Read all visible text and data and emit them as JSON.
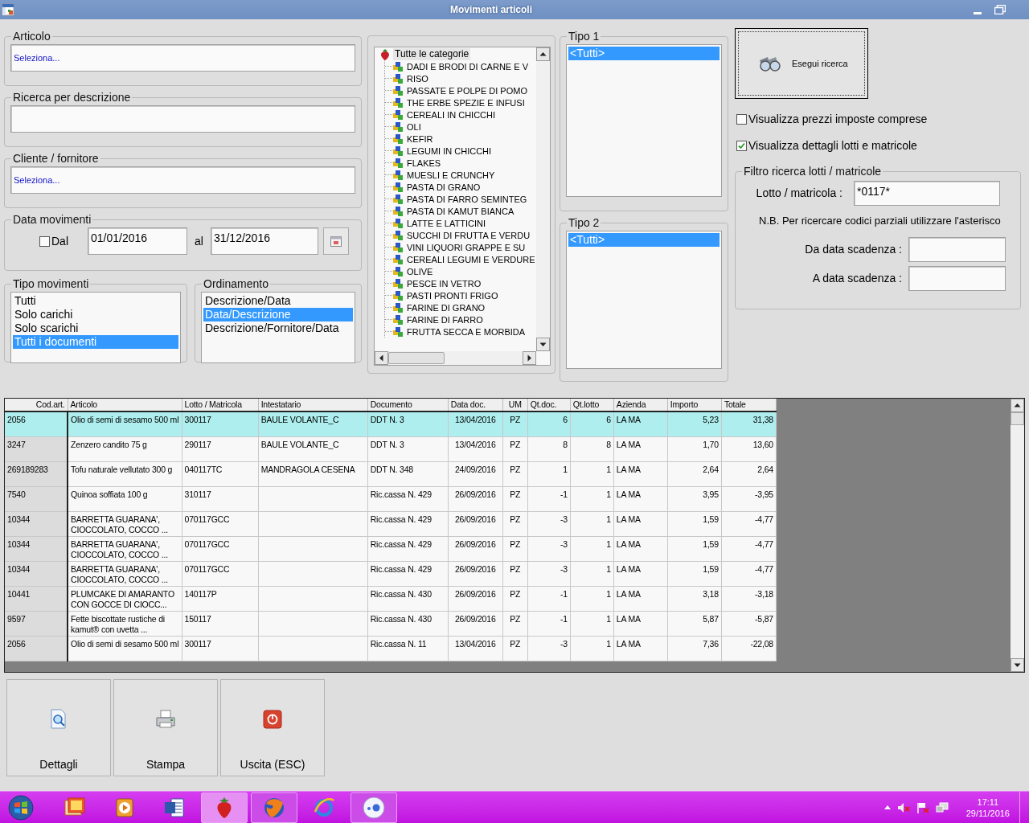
{
  "window": {
    "title": "Movimenti articoli"
  },
  "articolo": {
    "label": "Articolo",
    "value": "Seleziona..."
  },
  "ricerca_descrizione": {
    "label": "Ricerca per descrizione"
  },
  "cliente_fornitore": {
    "label": "Cliente / fornitore",
    "value": "Seleziona..."
  },
  "data_movimenti": {
    "label": "Data movimenti",
    "dal": {
      "label": "Dal",
      "checked": false
    },
    "from": "01/01/2016",
    "al_label": "al",
    "to": "31/12/2016"
  },
  "tipo_movimenti": {
    "label": "Tipo movimenti",
    "items": [
      {
        "label": "Tutti",
        "selected": false
      },
      {
        "label": "Solo carichi",
        "selected": false
      },
      {
        "label": "Solo scarichi",
        "selected": false
      },
      {
        "label": "Tutti i documenti",
        "selected": true
      }
    ]
  },
  "ordinamento": {
    "label": "Ordinamento",
    "items": [
      {
        "label": "Descrizione/Data",
        "selected": false
      },
      {
        "label": "Data/Descrizione",
        "selected": true
      },
      {
        "label": "Descrizione/Fornitore/Data",
        "selected": false
      }
    ]
  },
  "categories": {
    "label": "Tutte le categorie",
    "children": [
      {
        "label": "DADI E BRODI DI CARNE E V"
      },
      {
        "label": "RISO"
      },
      {
        "label": "PASSATE E POLPE DI POMO"
      },
      {
        "label": "THE ERBE SPEZIE E INFUSI"
      },
      {
        "label": "CEREALI IN CHICCHI"
      },
      {
        "label": "OLI"
      },
      {
        "label": "KEFIR"
      },
      {
        "label": "LEGUMI IN CHICCHI"
      },
      {
        "label": "FLAKES"
      },
      {
        "label": "MUESLI E CRUNCHY"
      },
      {
        "label": "PASTA DI GRANO"
      },
      {
        "label": "PASTA DI FARRO SEMINTEG"
      },
      {
        "label": "PASTA DI KAMUT BIANCA"
      },
      {
        "label": "LATTE E LATTICINI"
      },
      {
        "label": "SUCCHI DI FRUTTA E VERDU"
      },
      {
        "label": "VINI LIQUORI GRAPPE E SU"
      },
      {
        "label": "CEREALI LEGUMI E VERDURE"
      },
      {
        "label": "OLIVE"
      },
      {
        "label": "PESCE IN VETRO"
      },
      {
        "label": "PASTI PRONTI FRIGO"
      },
      {
        "label": "FARINE DI GRANO"
      },
      {
        "label": "FARINE DI FARRO"
      },
      {
        "label": "FRUTTA SECCA E MORBIDA"
      }
    ]
  },
  "tipo1": {
    "label": "Tipo 1",
    "items": [
      {
        "label": "<Tutti>",
        "selected": true
      }
    ]
  },
  "tipo2": {
    "label": "Tipo 2",
    "items": [
      {
        "label": "<Tutti>",
        "selected": true
      }
    ]
  },
  "search_button": {
    "label": "Esegui ricerca"
  },
  "options": [
    {
      "label": "Visualizza prezzi imposte comprese",
      "checked": false
    },
    {
      "label": "Visualizza dettagli lotti e matricole",
      "checked": true
    }
  ],
  "filtro_lotti": {
    "label": "Filtro ricerca lotti / matricole",
    "lotto_label": "Lotto / matricola :",
    "lotto_value": "*0117*",
    "note": "N.B. Per ricercare codici parziali utilizzare l'asterisco",
    "da_label": "Da data scadenza :",
    "a_label": "A data scadenza :"
  },
  "table": {
    "columns": [
      "Cod.art.",
      "Articolo",
      "Lotto / Matricola",
      "Intestatario",
      "Documento",
      "Data doc.",
      "UM",
      "Qt.doc.",
      "Qt.lotto",
      "Azienda",
      "Importo",
      "Totale"
    ],
    "rows": [
      {
        "selected": true,
        "cells": [
          "2056",
          "Olio di semi di sesamo 500 ml",
          "300117",
          "BAULE VOLANTE_C",
          "DDT N. 3",
          "13/04/2016",
          "PZ",
          "6",
          "6",
          "LA MA",
          "5,23",
          "31,38"
        ]
      },
      {
        "selected": false,
        "cells": [
          "3247",
          "Zenzero candito 75 g",
          "290117",
          "BAULE VOLANTE_C",
          "DDT N. 3",
          "13/04/2016",
          "PZ",
          "8",
          "8",
          "LA MA",
          "1,70",
          "13,60"
        ]
      },
      {
        "selected": false,
        "cells": [
          "269189283",
          "Tofu naturale vellutato 300 g",
          "040117TC",
          "MANDRAGOLA CESENA",
          "DDT N. 348",
          "24/09/2016",
          "PZ",
          "1",
          "1",
          "LA MA",
          "2,64",
          "2,64"
        ]
      },
      {
        "selected": false,
        "cells": [
          "7540",
          "Quinoa soffiata 100 g",
          "310117",
          "",
          "Ric.cassa N. 429",
          "26/09/2016",
          "PZ",
          "-1",
          "1",
          "LA MA",
          "3,95",
          "-3,95"
        ]
      },
      {
        "selected": false,
        "cells": [
          "10344",
          "BARRETTA GUARANA', CIOCCOLATO, COCCO ...",
          "070117GCC",
          "",
          "Ric.cassa N. 429",
          "26/09/2016",
          "PZ",
          "-3",
          "1",
          "LA MA",
          "1,59",
          "-4,77"
        ]
      },
      {
        "selected": false,
        "cells": [
          "10344",
          "BARRETTA GUARANA', CIOCCOLATO, COCCO ...",
          "070117GCC",
          "",
          "Ric.cassa N. 429",
          "26/09/2016",
          "PZ",
          "-3",
          "1",
          "LA MA",
          "1,59",
          "-4,77"
        ]
      },
      {
        "selected": false,
        "cells": [
          "10344",
          "BARRETTA GUARANA', CIOCCOLATO, COCCO ...",
          "070117GCC",
          "",
          "Ric.cassa N. 429",
          "26/09/2016",
          "PZ",
          "-3",
          "1",
          "LA MA",
          "1,59",
          "-4,77"
        ]
      },
      {
        "selected": false,
        "cells": [
          "10441",
          "PLUMCAKE DI AMARANTO CON GOCCE DI CIOCC...",
          "140117P",
          "",
          "Ric.cassa N. 430",
          "26/09/2016",
          "PZ",
          "-1",
          "1",
          "LA MA",
          "3,18",
          "-3,18"
        ]
      },
      {
        "selected": false,
        "cells": [
          "9597",
          "Fette biscottate rustiche di kamut® con uvetta ...",
          "150117",
          "",
          "Ric.cassa N. 430",
          "26/09/2016",
          "PZ",
          "-1",
          "1",
          "LA MA",
          "5,87",
          "-5,87"
        ]
      },
      {
        "selected": false,
        "cells": [
          "2056",
          "Olio di semi di sesamo 500 ml",
          "300117",
          "",
          "Ric.cassa N. 11",
          "13/04/2016",
          "PZ",
          "-3",
          "1",
          "LA MA",
          "7,36",
          "-22,08"
        ]
      }
    ]
  },
  "actions": [
    {
      "label": "Dettagli",
      "kind": "details"
    },
    {
      "label": "Stampa",
      "kind": "print"
    },
    {
      "label": "Uscita (ESC)",
      "kind": "exit"
    }
  ],
  "taskbar": {
    "apps": [
      {
        "kind": "pictures",
        "open": false,
        "selected": false
      },
      {
        "kind": "media",
        "open": false,
        "selected": false
      },
      {
        "kind": "document",
        "open": false,
        "selected": false
      },
      {
        "kind": "strawberry",
        "open": true,
        "selected": true
      },
      {
        "kind": "globe",
        "open": true,
        "selected": false
      },
      {
        "kind": "ring",
        "open": false,
        "selected": false
      },
      {
        "kind": "dots",
        "open": true,
        "selected": false
      }
    ],
    "time": "17:11",
    "date": "29/11/2016"
  }
}
